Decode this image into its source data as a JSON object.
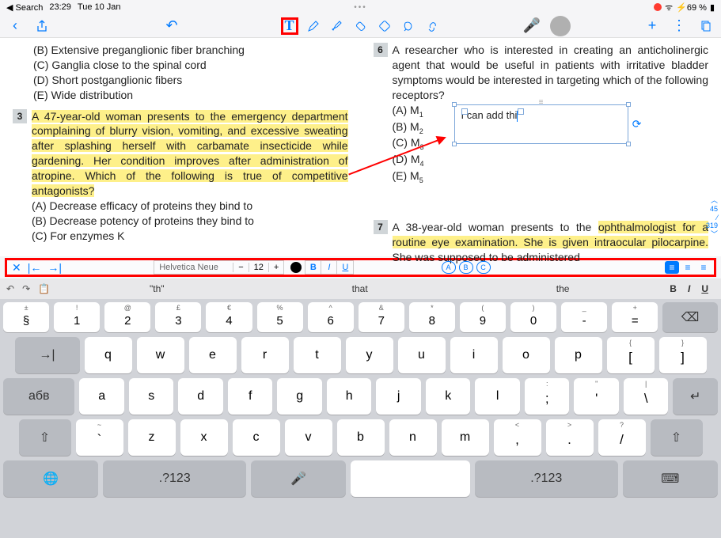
{
  "status": {
    "back": "Search",
    "time": "23:29",
    "date": "Tue 10 Jan",
    "battery": "69 %"
  },
  "question_left_opts": {
    "b": "(B)   Extensive preganglionic fiber branching",
    "c": "(C)   Ganglia close to the spinal cord",
    "d": "(D)   Short postganglionic fibers",
    "e": "(E)   Wide distribution"
  },
  "q3": {
    "num": "3",
    "text": "A 47-year-old woman presents to the emergency department complaining of blurry vision, vomiting, and excessive sweating after splashing herself with carbamate insecticide while gardening. Her condition improves after administration of atropine. Which of the following is true of competitive antagonists?",
    "a": "(A)   Decrease efficacy of proteins they bind to",
    "b": "(B)   Decrease potency of proteins they bind to",
    "c": "(C)   For enzymes  K"
  },
  "q6": {
    "num": "6",
    "text": "A researcher who is interested in creating an anticholinergic agent that would be useful in patients with irritative bladder symptoms would be interested in targeting which of the following receptors?",
    "a": "(A)   M",
    "b": "(B)   M",
    "c": "(C)   M",
    "d": "(D)   M",
    "e": "(E)   M"
  },
  "q7": {
    "num": "7",
    "t1": "A 38-year-old woman presents to the ",
    "t2": "ophthalmologist for a ",
    "t3": "routine eye examination. She is given intraocular pilocarpine.",
    "t4": " She was supposed to be administered"
  },
  "textbox": {
    "value": "I can add thi"
  },
  "page": {
    "cur": "45",
    "total": "319"
  },
  "format": {
    "font": "Helvetica Neue",
    "size": "12",
    "A": "A",
    "B": "B",
    "C": "C"
  },
  "suggest": {
    "s1": "\"th\"",
    "s2": "that",
    "s3": "the"
  },
  "keys": {
    "nrow": [
      {
        "alt": "±",
        "main": "§"
      },
      {
        "alt": "!",
        "main": "1"
      },
      {
        "alt": "@",
        "main": "2"
      },
      {
        "alt": "£",
        "main": "3"
      },
      {
        "alt": "€",
        "main": "4"
      },
      {
        "alt": "%",
        "main": "5"
      },
      {
        "alt": "^",
        "main": "6"
      },
      {
        "alt": "&",
        "main": "7"
      },
      {
        "alt": "*",
        "main": "8"
      },
      {
        "alt": "(",
        "main": "9"
      },
      {
        "alt": ")",
        "main": "0"
      },
      {
        "alt": "_",
        "main": "-"
      },
      {
        "alt": "+",
        "main": "="
      }
    ],
    "r1": [
      "q",
      "w",
      "e",
      "r",
      "t",
      "y",
      "u",
      "i",
      "o",
      "p"
    ],
    "r1b": [
      {
        "alt": "{",
        "main": "["
      },
      {
        "alt": "}",
        "main": "]"
      }
    ],
    "r2": [
      "a",
      "s",
      "d",
      "f",
      "g",
      "h",
      "j",
      "k",
      "l"
    ],
    "r2b": [
      {
        "alt": ":",
        "main": ";"
      },
      {
        "alt": "\"",
        "main": "'"
      },
      {
        "alt": "|",
        "main": "\\"
      }
    ],
    "r3a": {
      "alt": "~",
      "main": "`"
    },
    "r3": [
      "z",
      "x",
      "c",
      "v",
      "b",
      "n",
      "m"
    ],
    "r3b": [
      {
        "alt": "<",
        "main": ","
      },
      {
        "alt": ">",
        "main": "."
      },
      {
        "alt": "?",
        "main": "/"
      }
    ],
    "fn": {
      "tab": "→|",
      "abv": "абв",
      "shift": "⇧",
      "globe": "🌐",
      "numL": ".?123",
      "mic": "🎤",
      "numR": ".?123",
      "kbd": "⌨"
    }
  }
}
